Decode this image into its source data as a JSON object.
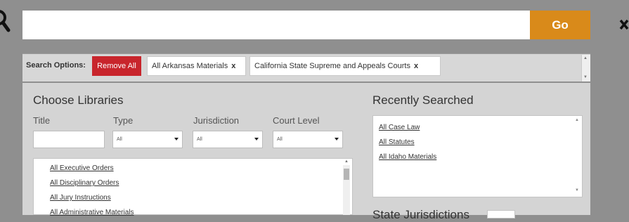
{
  "search": {
    "value": "",
    "placeholder": "",
    "go_label": "Go"
  },
  "icons": {
    "search": "search-icon",
    "close": "close-icon"
  },
  "options": {
    "label": "Search Options:",
    "remove_all_label": "Remove All",
    "chips": [
      {
        "label": "All Arkansas Materials",
        "remove": "x"
      },
      {
        "label": "California State Supreme and Appeals Courts",
        "remove": "x"
      }
    ]
  },
  "libraries": {
    "title": "Choose Libraries",
    "filters": {
      "title_label": "Title",
      "type_label": "Type",
      "jurisdiction_label": "Jurisdiction",
      "court_level_label": "Court Level",
      "type_value": "All",
      "jurisdiction_value": "All",
      "court_level_value": "All"
    },
    "items": [
      "All Executive Orders",
      "All Disciplinary Orders",
      "All Jury Instructions",
      "All Administrative Materials"
    ]
  },
  "recent": {
    "title": "Recently Searched",
    "items": [
      "All Case Law",
      "All Statutes",
      "All Idaho Materials"
    ]
  },
  "state": {
    "title": "State Jurisdictions"
  },
  "colors": {
    "go": "#d98a1a",
    "remove_all": "#c8252c",
    "panel": "#d4d4d4",
    "overlay": "#8f8f8f"
  }
}
